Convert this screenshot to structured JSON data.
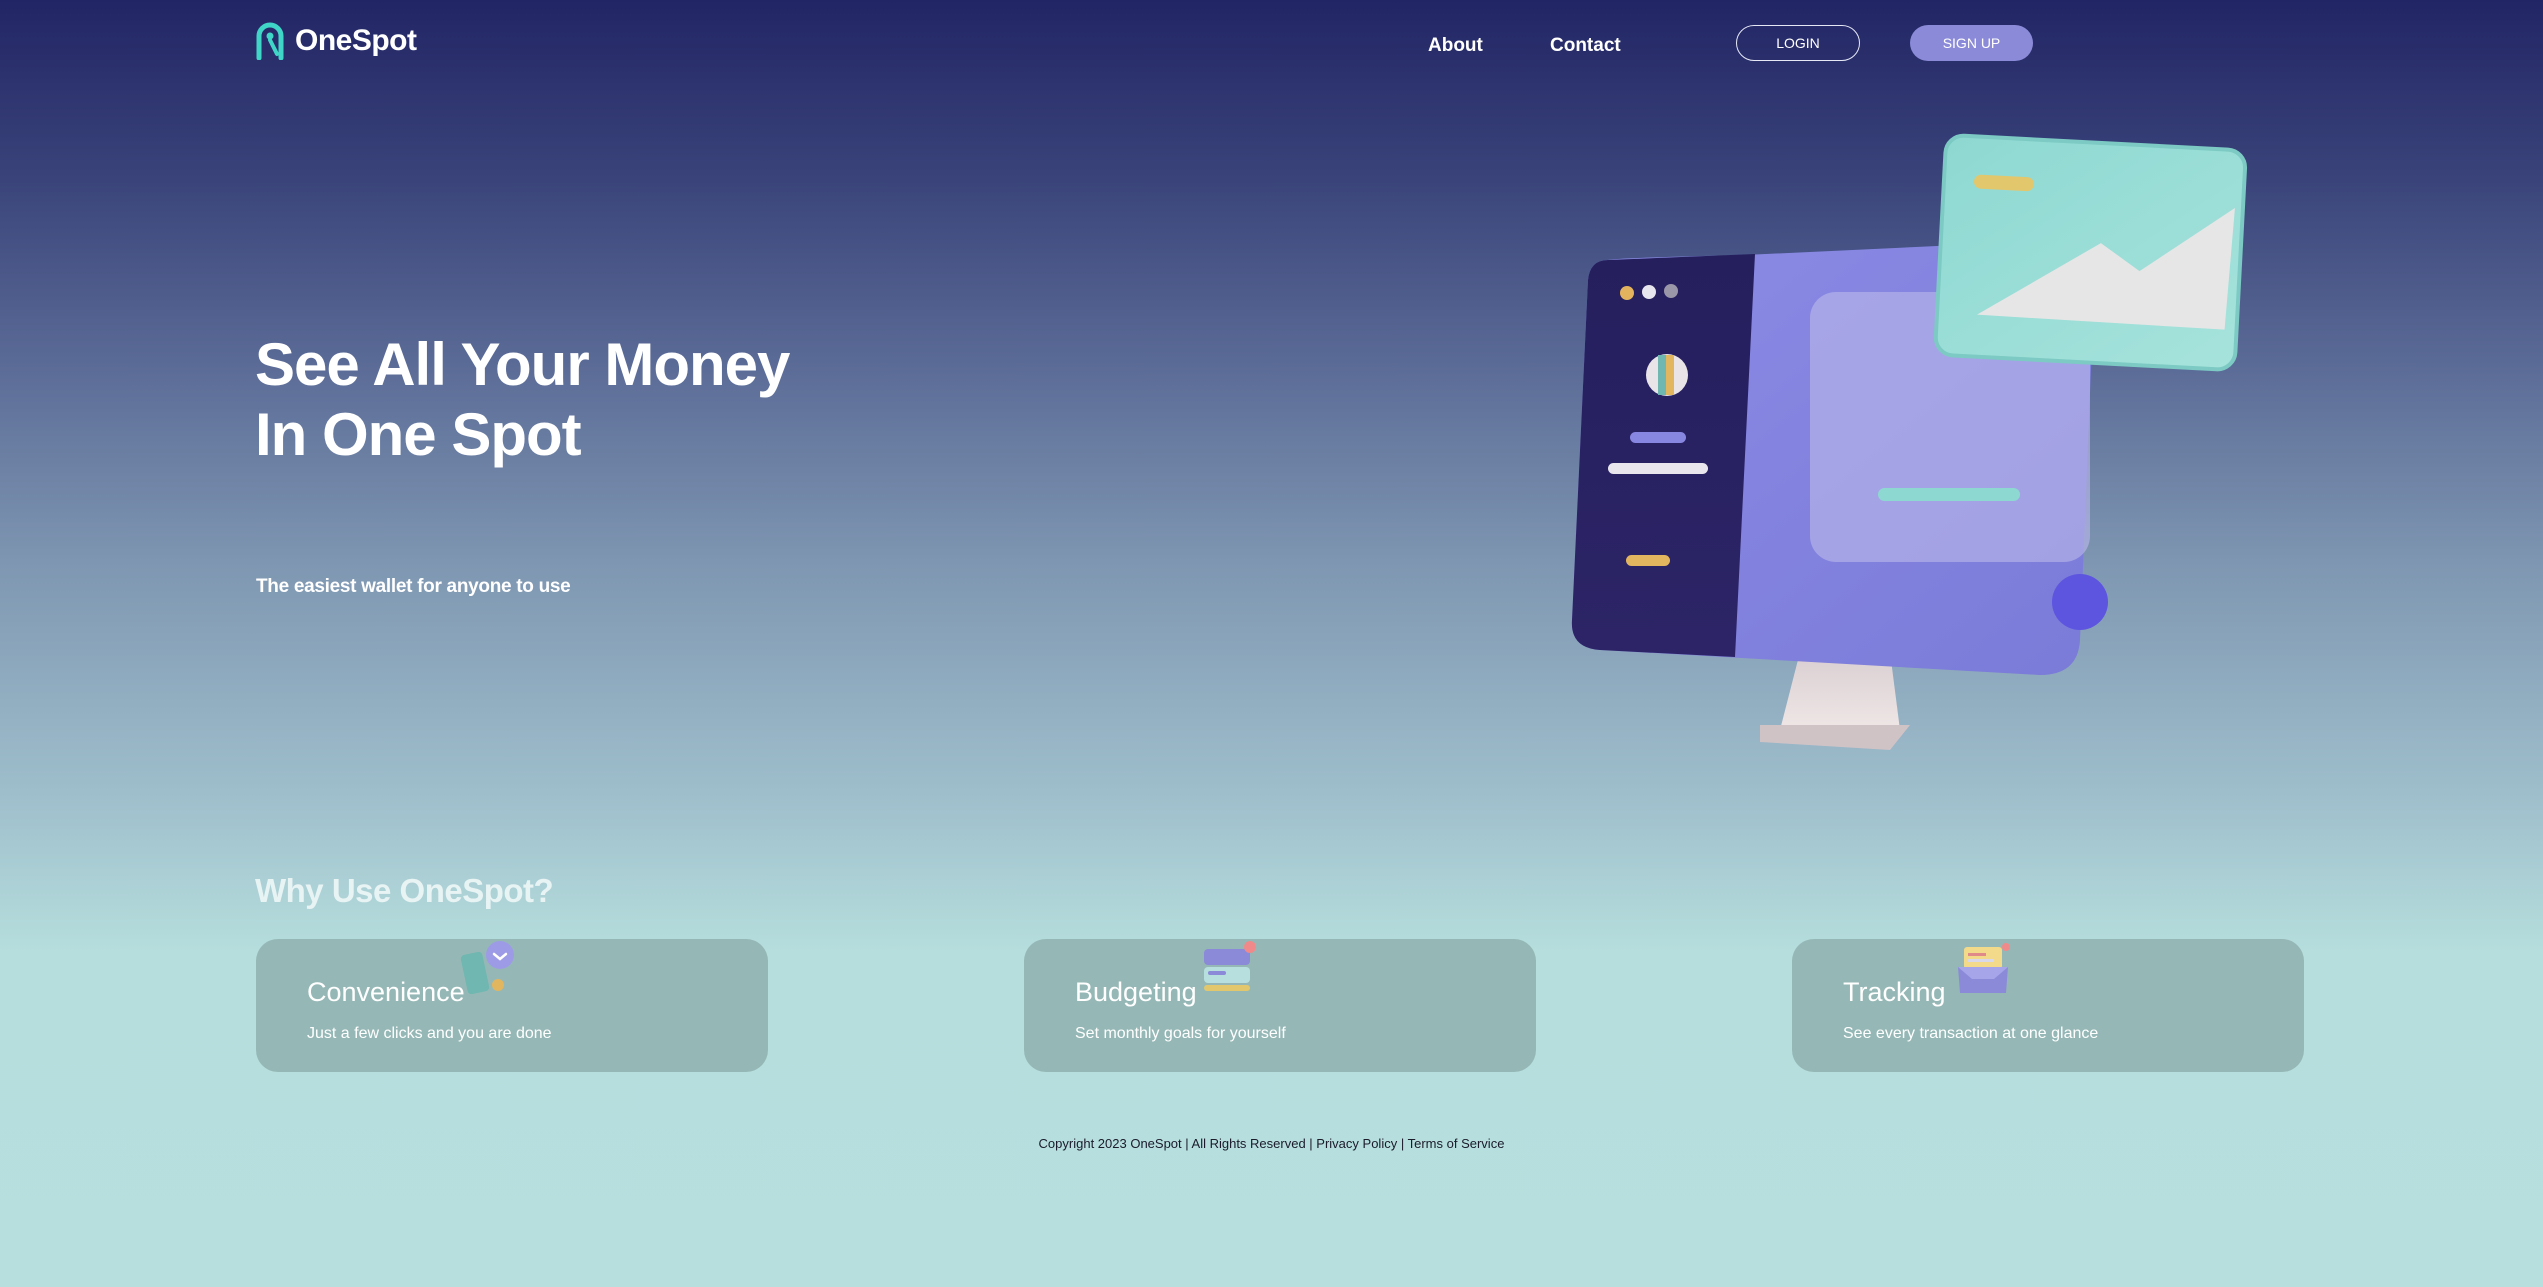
{
  "brand": {
    "name": "OneSpot"
  },
  "nav": {
    "about": "About",
    "contact": "Contact",
    "login": "LOGIN",
    "signup": "SIGN UP"
  },
  "hero": {
    "title_line1": "See All Your Money",
    "title_line2": "In One Spot",
    "subtitle": "The easiest wallet for anyone to use",
    "illustration": "desktop-monitor-illustration"
  },
  "features": {
    "heading": "Why Use OneSpot?",
    "cards": [
      {
        "title": "Convenience",
        "text": "Just a few clicks and you are done",
        "icon": "phone-wallet-icon"
      },
      {
        "title": "Budgeting",
        "text": "Set monthly goals for yourself",
        "icon": "cards-icon"
      },
      {
        "title": "Tracking",
        "text": "See every transaction at one glance",
        "icon": "inbox-icon"
      }
    ]
  },
  "footer": {
    "copyright": "Copyright 2023 OneSpot | All Rights Reserved |",
    "sep": "|",
    "privacy": "Privacy Policy",
    "terms": "Terms of Service"
  },
  "colors": {
    "accent": "#8b8ad8",
    "logo": "#3fd6c8",
    "card_bg": "#95b8b6",
    "bg_top": "#222565",
    "bg_bottom": "#b6dfde"
  }
}
